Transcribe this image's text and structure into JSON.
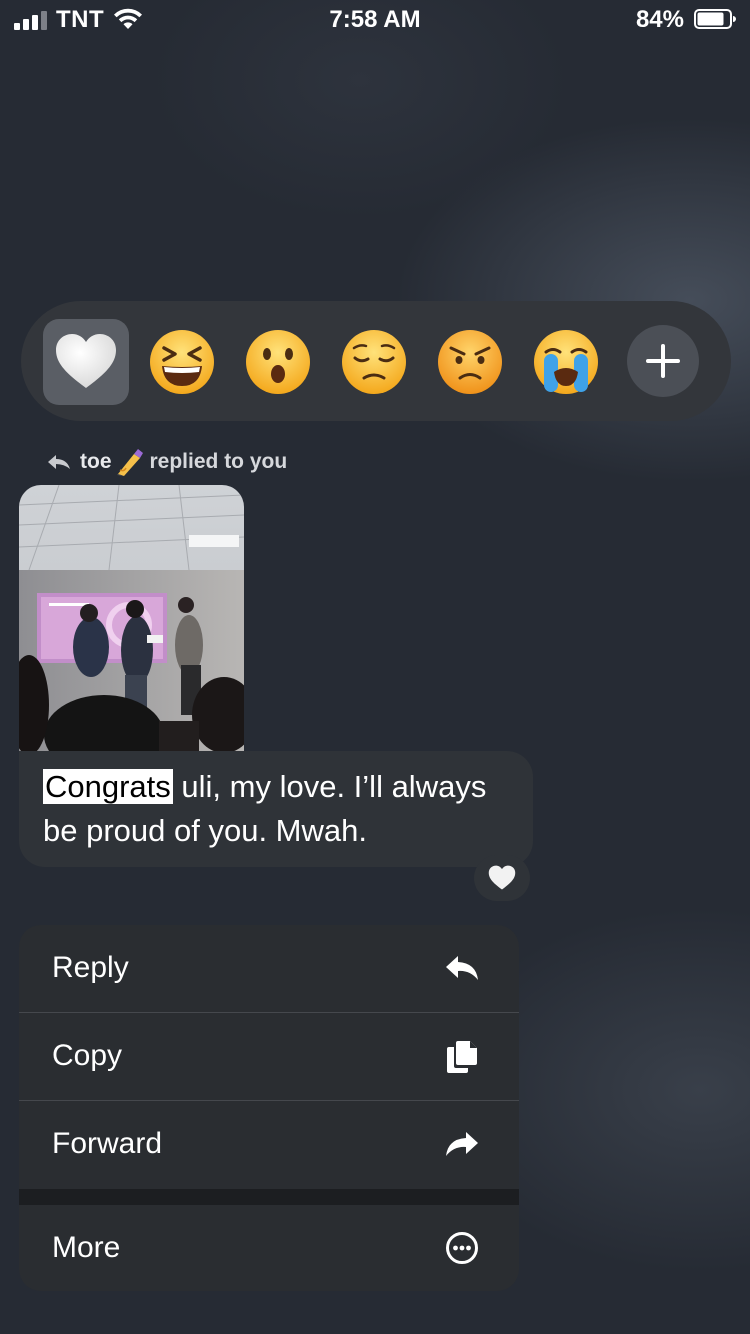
{
  "status_bar": {
    "carrier": "TNT",
    "time": "7:58 AM",
    "battery_percent": "84%",
    "battery_level": 0.84,
    "signal_bars": 3
  },
  "reactions": [
    {
      "name": "white-heart",
      "selected": true
    },
    {
      "name": "grinning-squinting-face"
    },
    {
      "name": "face-with-open-mouth"
    },
    {
      "name": "pensive-face"
    },
    {
      "name": "angry-face"
    },
    {
      "name": "loudly-crying-face"
    }
  ],
  "reply_header": {
    "name": "toe",
    "emoji": "writing-hand-emoji",
    "text": "replied to you"
  },
  "message": {
    "highlight": "Congrats",
    "text": " uli, my love. I’ll always be proud of you. Mwah.",
    "reaction": "white-heart"
  },
  "menu": {
    "reply": "Reply",
    "copy": "Copy",
    "forward": "Forward",
    "more": "More"
  }
}
